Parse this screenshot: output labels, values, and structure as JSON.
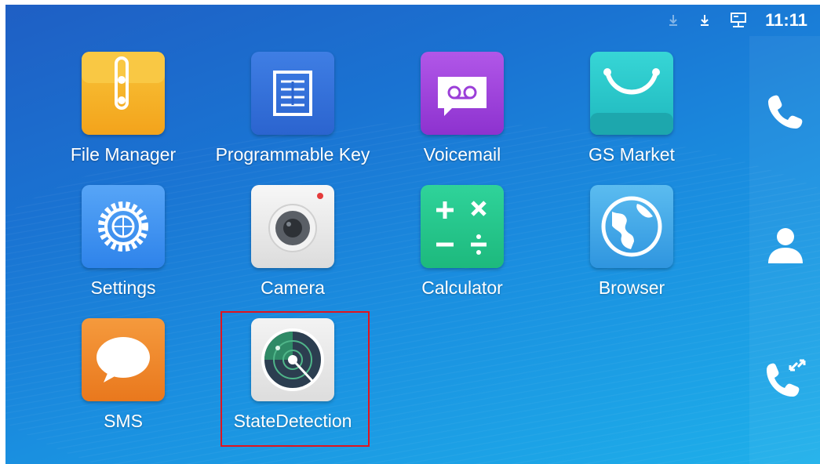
{
  "status_bar": {
    "time": "11:11",
    "icons": [
      "download-faded-icon",
      "download-icon",
      "network-icon"
    ]
  },
  "apps": [
    {
      "label": "File Manager",
      "icon": "file-manager-icon",
      "color": "#f5a623"
    },
    {
      "label": "Programmable Key",
      "icon": "programmable-key-icon",
      "color": "#2d6fd6"
    },
    {
      "label": "Voicemail",
      "icon": "voicemail-icon",
      "color": "#9b3fd8"
    },
    {
      "label": "GS Market",
      "icon": "gs-market-icon",
      "color": "#22c3c7"
    },
    {
      "label": "Settings",
      "icon": "settings-icon",
      "color": "#3b8df0"
    },
    {
      "label": "Camera",
      "icon": "camera-icon",
      "color": "#e8e8e8"
    },
    {
      "label": "Calculator",
      "icon": "calculator-icon",
      "color": "#23c88c"
    },
    {
      "label": "Browser",
      "icon": "browser-icon",
      "color": "#3fa6e8"
    },
    {
      "label": "SMS",
      "icon": "sms-icon",
      "color": "#f08a2c"
    },
    {
      "label": "StateDetection",
      "icon": "state-detection-icon",
      "color": "#e6e6e6"
    }
  ],
  "side_panel": {
    "buttons": [
      "phone-icon",
      "contacts-icon",
      "call-history-icon"
    ]
  },
  "highlight_color": "#e0141e"
}
